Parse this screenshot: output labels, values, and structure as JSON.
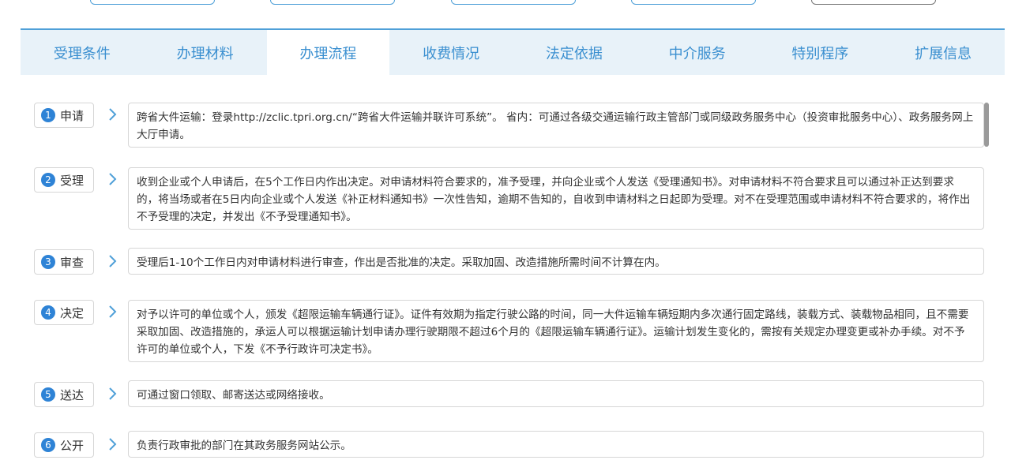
{
  "tabs": [
    {
      "label": "受理条件"
    },
    {
      "label": "办理材料"
    },
    {
      "label": "办理流程",
      "active": true
    },
    {
      "label": "收费情况"
    },
    {
      "label": "法定依据"
    },
    {
      "label": "中介服务"
    },
    {
      "label": "特别程序"
    },
    {
      "label": "扩展信息"
    }
  ],
  "steps": [
    {
      "num": "1",
      "label": "申请",
      "text": "跨省大件运输：登录http://zclic.tpri.org.cn/“跨省大件运输并联许可系统”。 省内：可通过各级交通运输行政主管部门或同级政务服务中心（投资审批服务中心）、政务服务网上大厅申请。"
    },
    {
      "num": "2",
      "label": "受理",
      "text": "收到企业或个人申请后，在5个工作日内作出决定。对申请材料符合要求的，准予受理，并向企业或个人发送《受理通知书》。对申请材料不符合要求且可以通过补正达到要求的，将当场或者在5日内向企业或个人发送《补正材料通知书》一次性告知，逾期不告知的，自收到申请材料之日起即为受理。对不在受理范围或申请材料不符合要求的，将作出不予受理的决定，并发出《不予受理通知书》。"
    },
    {
      "num": "3",
      "label": "审查",
      "text": "受理后1-10个工作日内对申请材料进行审查，作出是否批准的决定。采取加固、改造措施所需时间不计算在内。"
    },
    {
      "num": "4",
      "label": "决定",
      "text": "对予以许可的单位或个人，颁发《超限运输车辆通行证》。证件有效期为指定行驶公路的时间，同一大件运输车辆短期内多次通行固定路线，装载方式、装载物品相同，且不需要采取加固、改造措施的，承运人可以根据运输计划申请办理行驶期限不超过6个月的《超限运输车辆通行证》。运输计划发生变化的，需按有关规定办理变更或补办手续。对不予许可的单位或个人，下发《不予行政许可决定书》。"
    },
    {
      "num": "5",
      "label": "送达",
      "text": "可通过窗口领取、邮寄送达或网络接收。"
    },
    {
      "num": "6",
      "label": "公开",
      "text": "负责行政审批的部门在其政务服务网站公示。"
    }
  ],
  "colors": {
    "accent": "#2e83d6",
    "tab_text": "#3a8fd0",
    "tab_bg": "#e8f2f9"
  },
  "icons": {
    "step_arrow": "chevron-right-icon"
  }
}
